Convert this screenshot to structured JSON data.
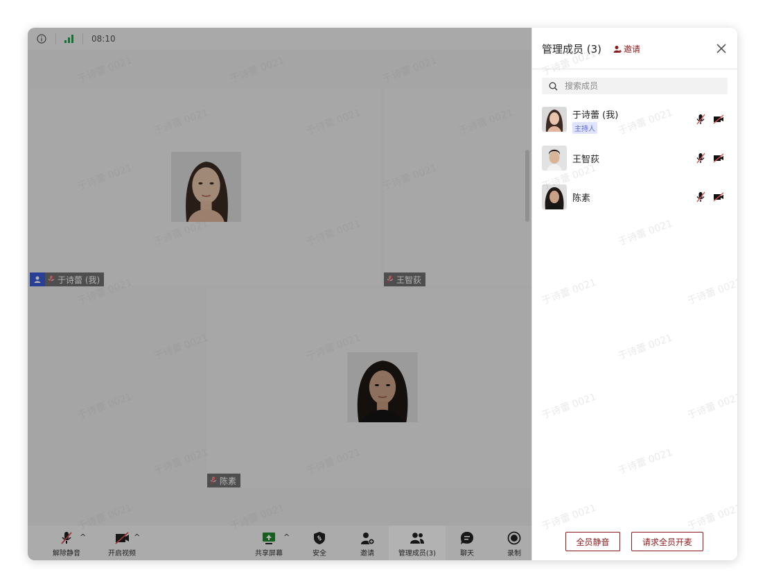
{
  "status_bar": {
    "time": "08:10"
  },
  "participants_grid": [
    {
      "name": "于诗蕾 (我)",
      "is_host": true
    },
    {
      "name": "王智荻",
      "is_host": false
    },
    {
      "name": "陈素",
      "is_host": false
    }
  ],
  "toolbar": {
    "unmute": "解除静音",
    "start_video": "开启视频",
    "share_screen": "共享屏幕",
    "security": "安全",
    "invite": "邀请",
    "manage_members": "管理成员(3)",
    "chat": "聊天",
    "record": "录制"
  },
  "panel": {
    "title": "管理成员 (3)",
    "invite": "邀请",
    "search": {
      "placeholder": "搜索成员",
      "value": ""
    },
    "members": [
      {
        "name": "于诗蕾 (我)",
        "role": "主持人"
      },
      {
        "name": "王智荻",
        "role": ""
      },
      {
        "name": "陈素",
        "role": ""
      }
    ],
    "mute_all": "全员静音",
    "request_unmute_all": "请求全员开麦"
  },
  "watermark": "于诗蕾 0021",
  "colors": {
    "accent": "#8b1a1a",
    "host_badge": "#3b5bd6",
    "signal": "#1aa34a"
  }
}
